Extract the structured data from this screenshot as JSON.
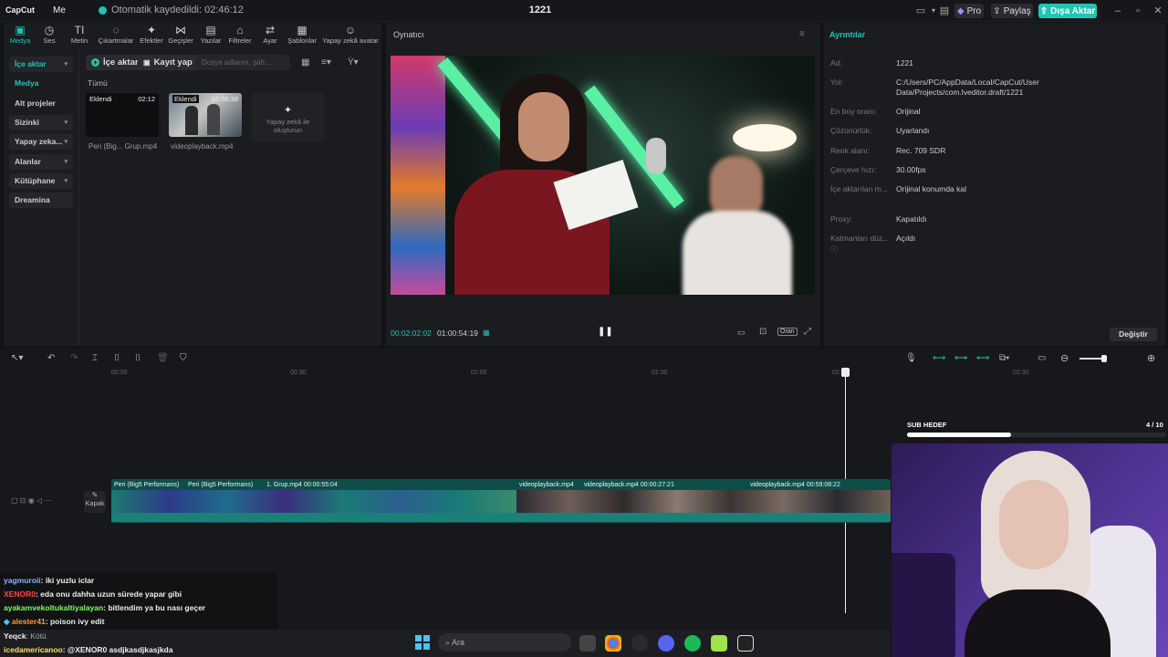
{
  "window": {
    "app_name": "CapCut",
    "menu_label": "Me",
    "autosave_text": "Otomatik kaydedildi: 02:46:12",
    "project_title": "1221",
    "pro_label": "Pro",
    "share_label": "Paylaş",
    "export_label": "Dışa Aktar"
  },
  "toolbar": {
    "tabs": [
      {
        "label": "Medya",
        "icon": "media-icon"
      },
      {
        "label": "Ses",
        "icon": "audio-icon"
      },
      {
        "label": "Metin",
        "icon": "text-icon"
      },
      {
        "label": "Çıkartmalar",
        "icon": "sticker-icon"
      },
      {
        "label": "Efektler",
        "icon": "effects-icon"
      },
      {
        "label": "Geçişler",
        "icon": "transitions-icon"
      },
      {
        "label": "Yazılar",
        "icon": "captions-icon"
      },
      {
        "label": "Filtreler",
        "icon": "filters-icon"
      },
      {
        "label": "Ayar",
        "icon": "adjust-icon"
      },
      {
        "label": "Şablonlar",
        "icon": "templates-icon"
      },
      {
        "label": "Yapay zekâ avatar",
        "icon": "ai-avatar-icon"
      }
    ]
  },
  "sidebar": {
    "items": [
      {
        "label": "İçe aktar",
        "has_chevron": true
      },
      {
        "label": "Medya",
        "has_chevron": false
      },
      {
        "label": "Alt projeler",
        "has_chevron": false
      },
      {
        "label": "Sizinki",
        "has_chevron": true
      },
      {
        "label": "Yapay zeka...",
        "has_chevron": true
      },
      {
        "label": "Alanlar",
        "has_chevron": true
      },
      {
        "label": "Kütüphane",
        "has_chevron": true
      },
      {
        "label": "Dreamina",
        "has_chevron": false
      }
    ]
  },
  "media": {
    "import_label": "İçe aktar",
    "record_label": "Kayıt yap",
    "search_placeholder": "Dosya adlarını, şah...",
    "filter_label": "Tümü",
    "items": [
      {
        "badge": "Eklendi",
        "duration": "02:12",
        "name": "Peri (Big... Grup.mp4"
      },
      {
        "badge": "Eklendi",
        "duration": "01:06:38",
        "name": "videoplayback.mp4"
      }
    ],
    "ai_create_label": "Yapay zekâ ile oluşturun"
  },
  "player": {
    "title": "Oynatıcı",
    "current_time": "00:02:02:02",
    "total_time": "01:00:54:19",
    "ratio_label": "Oran"
  },
  "details": {
    "title": "Ayrıntılar",
    "rows": [
      {
        "label": "Ad:",
        "value": "1221"
      },
      {
        "label": "Yol:",
        "value": "C:/Users/PC/AppData/Local/CapCut/User Data/Projects/com.lveditor.draft/1221"
      },
      {
        "label": "En boy oranı:",
        "value": "Orijinal"
      },
      {
        "label": "Çözünürlük:",
        "value": "Uyarlandı"
      },
      {
        "label": "Renk alanı:",
        "value": "Rec. 709 SDR"
      },
      {
        "label": "Çerçeve hızı:",
        "value": "30.00fps"
      },
      {
        "label": "İçe aktarılan m...",
        "value": "Orijinal konumda kal"
      },
      {
        "label": "Proxy:",
        "value": "Kapatıldı"
      },
      {
        "label": "Katmanları düz...",
        "value": "Açıldı"
      }
    ],
    "change_label": "Değiştir"
  },
  "timeline": {
    "ruler": [
      "00:00",
      "00:30",
      "01:00",
      "01:30",
      "02:00",
      "02:30"
    ],
    "cover_label": "Kapak",
    "clip_labels": [
      "Peri (Big5 Performans)",
      "Peri (Big5 Performans)",
      "1. Grup.mp4  00:00:55:04",
      "videoplayback.mp4",
      "videoplayback.mp4  00:00:27:21",
      "videoplayback.mp4  00:59:08:22"
    ]
  },
  "overlay": {
    "sub_goal_label": "SUB HEDEF",
    "sub_goal_count": "4 / 10",
    "sub_goal_progress": 0.4
  },
  "chat": [
    {
      "user": "yagmuroii",
      "msg": ": iki yuzlu iclar",
      "color": "#8ab4ff"
    },
    {
      "user": "XENOR0",
      "msg": ": eda onu dahha uzun sürede yapar gibi",
      "color": "#ff4444"
    },
    {
      "user": "ayakamvekoltukaltiyalayan",
      "msg": ": bitlendim ya bu nası geçer",
      "color": "#7dff5a"
    },
    {
      "user": "alester41",
      "msg": ": poison ivy edit",
      "color": "#ff9a3c"
    },
    {
      "user": "Yeqck",
      "msg": ": Kötü",
      "color": "#ffffff"
    },
    {
      "user": "icedamericanoo",
      "msg": ": @XENOR0 asdjkasdjkasjkda",
      "color": "#ffe15a"
    }
  ],
  "taskbar": {
    "search_placeholder": "Ara"
  },
  "colors": {
    "accent": "#21c4b3",
    "export": "#21c4b3"
  }
}
